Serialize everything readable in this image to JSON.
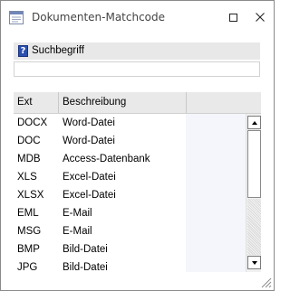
{
  "window": {
    "title": "Dokumenten-Matchcode"
  },
  "search": {
    "label": "Suchbegriff",
    "value": "",
    "help_symbol": "?"
  },
  "list": {
    "columns": [
      "Ext",
      "Beschreibung"
    ],
    "rows": [
      {
        "ext": "DOCX",
        "desc": "Word-Datei"
      },
      {
        "ext": "DOC",
        "desc": "Word-Datei"
      },
      {
        "ext": "MDB",
        "desc": "Access-Datenbank"
      },
      {
        "ext": "XLS",
        "desc": "Excel-Datei"
      },
      {
        "ext": "XLSX",
        "desc": "Excel-Datei"
      },
      {
        "ext": "EML",
        "desc": "E-Mail"
      },
      {
        "ext": "MSG",
        "desc": "E-Mail"
      },
      {
        "ext": "BMP",
        "desc": "Bild-Datei"
      },
      {
        "ext": "JPG",
        "desc": "Bild-Datei"
      }
    ],
    "scroll_position": 0
  },
  "colors": {
    "header_bg": "#e8e8e8",
    "list_bg": "#f5f6fb",
    "help_icon": "#2a4fae"
  },
  "icons": {
    "app": "document-list-icon",
    "maximize": "maximize-icon",
    "close": "close-icon",
    "help": "help-icon",
    "grip": "resize-grip-icon"
  }
}
